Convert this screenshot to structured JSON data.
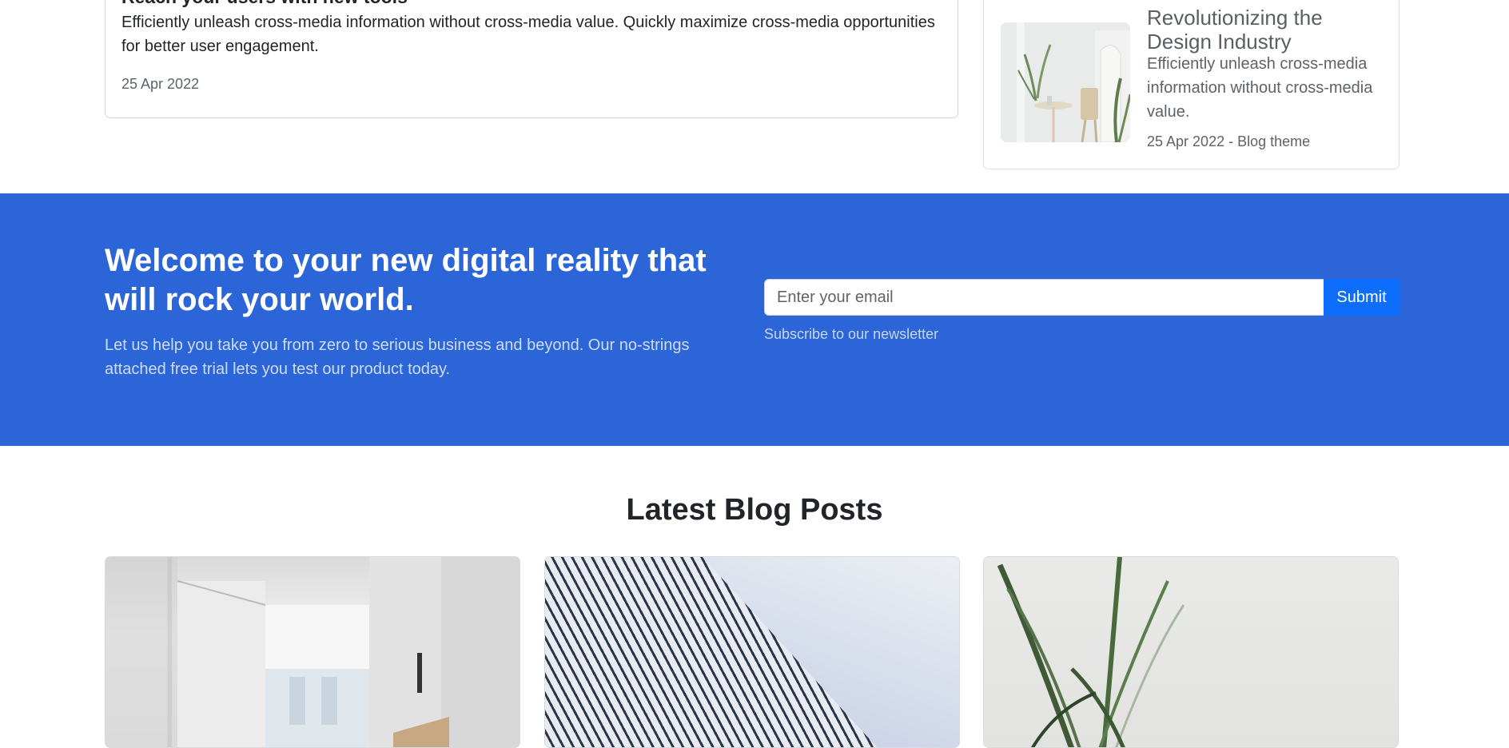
{
  "featured_card": {
    "title": "Reach your users with new tools",
    "text": "Efficiently unleash cross-media information without cross-media value. Quickly maximize cross-media opportunities for better user engagement.",
    "date": "25 Apr 2022"
  },
  "side_card": {
    "title": "Revolutionizing the Design Industry",
    "text": "Efficiently unleash cross-media information without cross-media value.",
    "meta": "25 Apr 2022 - Blog theme"
  },
  "banner": {
    "heading": "Welcome to your new digital reality that will rock your world.",
    "lead": "Let us help you take you from zero to serious business and beyond. Our no-strings attached free trial lets you test our product today.",
    "email_placeholder": "Enter your email",
    "submit_label": "Submit",
    "help_text": "Subscribe to our newsletter",
    "background_color": "#2c65d8",
    "button_color": "#0d6efd"
  },
  "latest_posts": {
    "title": "Latest Blog Posts"
  }
}
